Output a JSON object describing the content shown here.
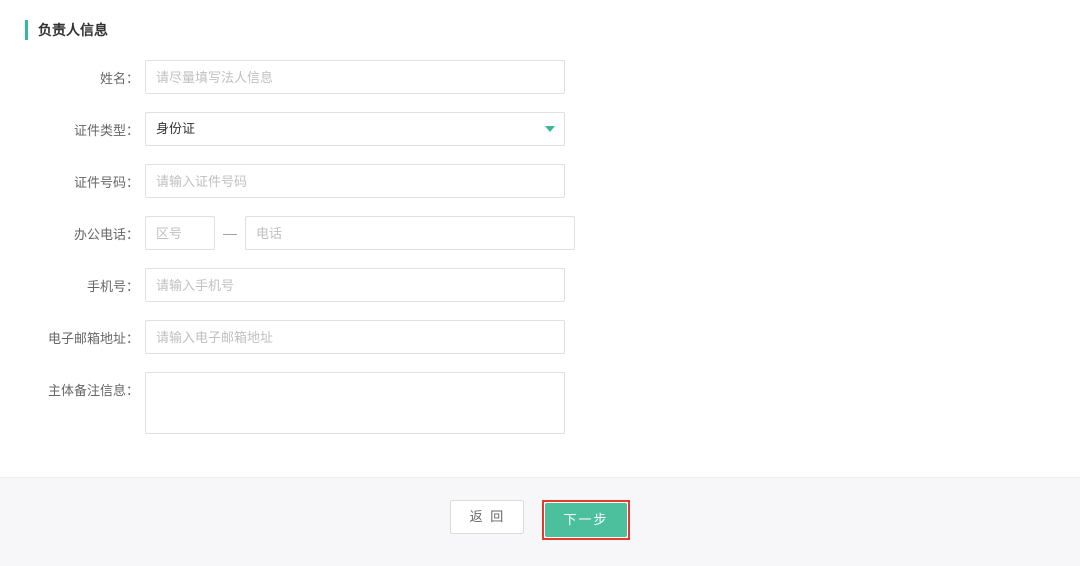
{
  "section": {
    "title": "负责人信息"
  },
  "labels": {
    "name": "姓名：",
    "id_type": "证件类型：",
    "id_number": "证件号码：",
    "office_phone": "办公电话：",
    "mobile": "手机号：",
    "email": "电子邮箱地址：",
    "remark": "主体备注信息："
  },
  "placeholders": {
    "name": "请尽量填写法人信息",
    "id_number": "请输入证件号码",
    "area_code": "区号",
    "phone": "电话",
    "mobile": "请输入手机号",
    "email": "请输入电子邮箱地址"
  },
  "values": {
    "id_type": "身份证"
  },
  "buttons": {
    "back": "返 回",
    "next": "下一步"
  },
  "separator": "—"
}
